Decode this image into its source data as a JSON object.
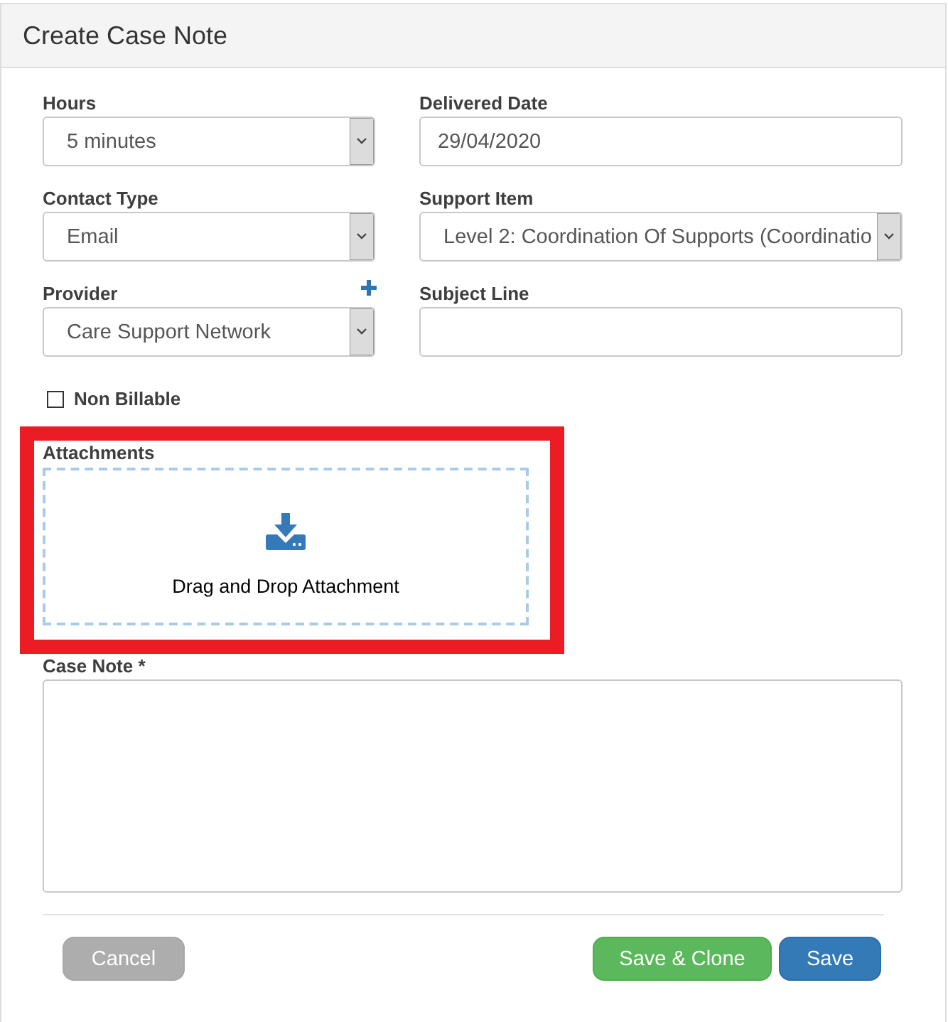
{
  "dialog": {
    "title": "Create Case Note"
  },
  "fields": [
    {
      "kind": "select",
      "label": "Hours",
      "value": "5 minutes"
    },
    {
      "kind": "text",
      "label": "Delivered Date",
      "value": "29/04/2020"
    },
    {
      "kind": "select",
      "label": "Contact Type",
      "value": "Email"
    },
    {
      "kind": "select",
      "label": "Support Item",
      "value": "Level 2: Coordination Of Supports (Coordinatio"
    },
    {
      "kind": "select",
      "label": "Provider",
      "value": "Care Support Network",
      "add_button": true
    },
    {
      "kind": "text",
      "label": "Subject Line"
    }
  ],
  "non_billable": {
    "label": "Non Billable",
    "checked": false
  },
  "attachments": {
    "label": "Attachments",
    "highlighted": true,
    "dropzone_text": "Drag and Drop Attachment"
  },
  "case_note": {
    "label": "Case Note *"
  },
  "buttons": [
    {
      "kind": "cancel",
      "label": "Cancel",
      "disabled": true
    },
    {
      "kind": "success",
      "label": "Save & Clone",
      "disabled": false
    },
    {
      "kind": "primary",
      "label": "Save",
      "disabled": false
    }
  ]
}
